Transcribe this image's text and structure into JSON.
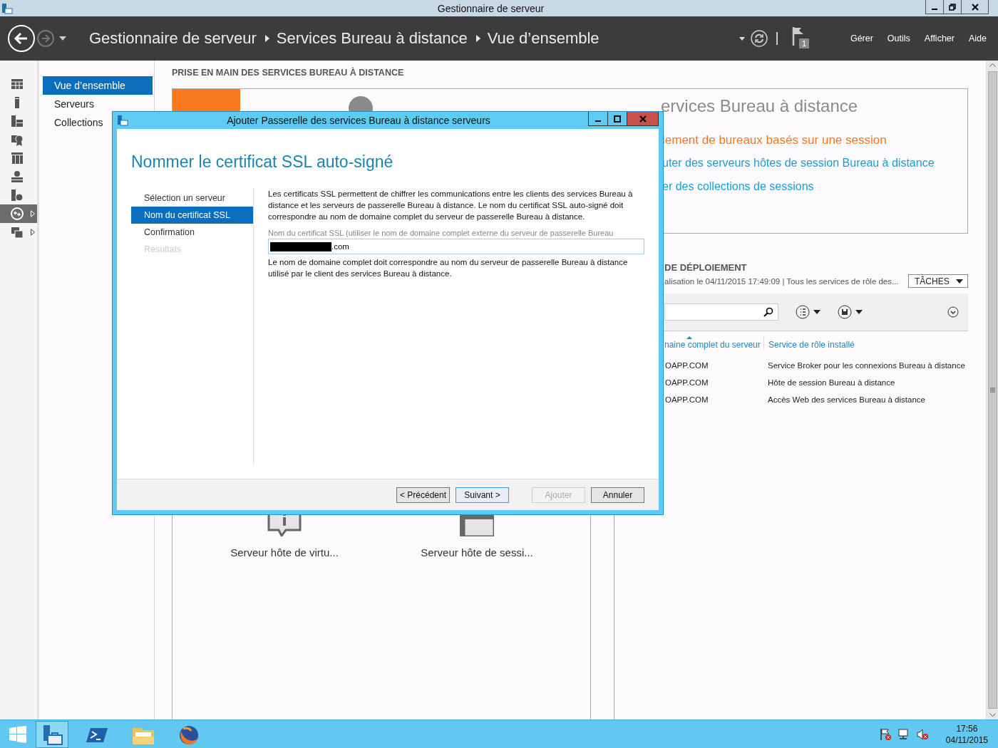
{
  "window": {
    "title": "Gestionnaire de serveur"
  },
  "header": {
    "breadcrumb": [
      "Gestionnaire de serveur",
      "Services Bureau à distance",
      "Vue d’ensemble"
    ],
    "notification_count": "1",
    "menus": [
      "Gérer",
      "Outils",
      "Afficher",
      "Aide"
    ]
  },
  "rail": [
    {
      "kind": "grid",
      "selected": false,
      "expandable": false
    },
    {
      "kind": "server",
      "selected": false,
      "expandable": false
    },
    {
      "kind": "servers",
      "selected": false,
      "expandable": false
    },
    {
      "kind": "certificate",
      "selected": false,
      "expandable": false
    },
    {
      "kind": "cluster",
      "selected": false,
      "expandable": false
    },
    {
      "kind": "network",
      "selected": false,
      "expandable": false
    },
    {
      "kind": "globe",
      "selected": false,
      "expandable": false
    },
    {
      "kind": "remote",
      "selected": true,
      "expandable": true
    },
    {
      "kind": "folders",
      "selected": false,
      "expandable": true
    }
  ],
  "nav": [
    {
      "label": "Vue d’ensemble",
      "selected": true
    },
    {
      "label": "Serveurs",
      "selected": false
    },
    {
      "label": "Collections",
      "selected": false
    }
  ],
  "content": {
    "heading": "PRISE EN MAIN DES SERVICES BUREAU À DISTANCE",
    "quick_start": {
      "title": "ervices Bureau à distance",
      "links": [
        {
          "text": "iement de bureaux basés sur une session",
          "kind": "current"
        },
        {
          "text": "uter des serveurs hôtes de session Bureau à distance",
          "kind": "link"
        },
        {
          "text": "er des collections de sessions",
          "kind": "link"
        }
      ]
    },
    "overview": {
      "roles": [
        {
          "kind": "virtualization",
          "label": "Serveur hôte de virtu..."
        },
        {
          "kind": "session",
          "label": "Serveur hôte de sessi..."
        }
      ]
    },
    "servers": {
      "title": "DE DÉPLOIEMENT",
      "subtitle": "alisation le 04/11/2015 17:49:09 | Tous les services de rôle des...",
      "tasks": "TÂCHES",
      "columns": [
        {
          "label": "naine complet du serveur",
          "sorted": true
        },
        {
          "label": "Service de rôle installé",
          "sorted": false
        }
      ],
      "rows": [
        [
          "OAPP.COM",
          "Service Broker pour les connexions Bureau à distance"
        ],
        [
          "OAPP.COM",
          "Hôte de session Bureau à distance"
        ],
        [
          "OAPP.COM",
          "Accès Web des services Bureau à distance"
        ]
      ]
    }
  },
  "dialog": {
    "title": "Ajouter Passerelle des services Bureau à distance serveurs",
    "heading": "Nommer le certificat SSL auto-signé",
    "steps": [
      {
        "label": "Sélection un serveur",
        "selected": false,
        "disabled": false
      },
      {
        "label": "Nom du certificat SSL",
        "selected": true,
        "disabled": false
      },
      {
        "label": "Confirmation",
        "selected": false,
        "disabled": false
      },
      {
        "label": "Résultats",
        "selected": false,
        "disabled": true
      }
    ],
    "description": "Les certificats SSL permettent de chiffrer les communications entre les clients des services Bureau à distance et les serveurs de passerelle Bureau à distance. Le nom du certificat SSL auto-signé doit correspondre au nom de domaine complet du serveur de passerelle Bureau à distance.",
    "field": {
      "label": "Nom du certificat SSL (utiliser le nom de domaine complet externe du serveur de passerelle Bureau",
      "value": ".com",
      "redacted": true
    },
    "note": "Le nom de domaine complet doit correspondre au nom du serveur de passerelle Bureau à distance utilisé par le client des services Bureau à distance.",
    "buttons": [
      {
        "label": "< Précédent",
        "default": false,
        "disabled": false
      },
      {
        "label": "Suivant >",
        "default": true,
        "disabled": false
      },
      {
        "label": "Ajouter",
        "default": false,
        "disabled": true
      },
      {
        "label": "Annuler",
        "default": false,
        "disabled": false
      }
    ]
  },
  "taskbar": {
    "apps": [
      {
        "kind": "server-manager",
        "selected": true
      },
      {
        "kind": "powershell",
        "selected": false
      },
      {
        "kind": "explorer",
        "selected": false
      },
      {
        "kind": "browser",
        "selected": false
      }
    ],
    "time": "17:56",
    "date": "04/11/2015"
  }
}
